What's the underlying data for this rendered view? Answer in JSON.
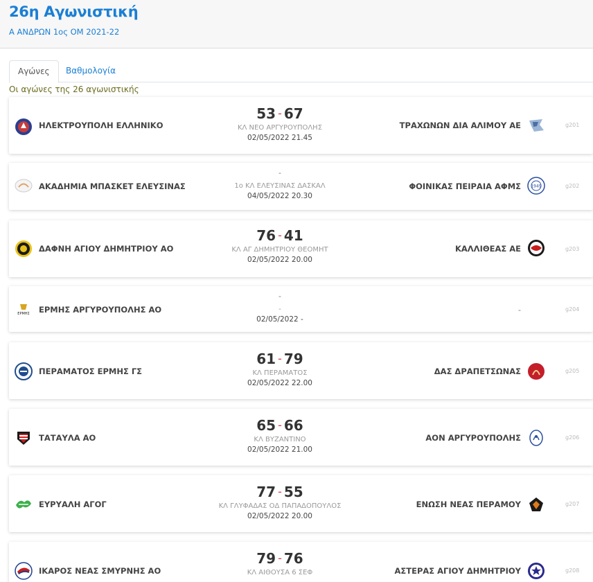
{
  "header": {
    "title": "26η Αγωνιστική",
    "subtitle": "Α ΑΝΔΡΩΝ 1ος ΟΜ 2021-22"
  },
  "tabs": [
    {
      "label": "Αγώνες",
      "active": true
    },
    {
      "label": "Βαθμολογία",
      "active": false
    }
  ],
  "section_caption": "Οι αγώνες της 26 αγωνιστικής",
  "colors": {
    "accent": "#1a7fd4",
    "score_dash": "#cc4444",
    "caption": "#6b6b1e"
  },
  "matches": [
    {
      "home": "ΗΛΕΚΤΡΟΥΠΟΛΗ ΕΛΛΗΝΙΚΟ",
      "away": "ΤΡΑΧΩΝΩΝ ΔΙΑ ΑΛΙΜΟΥ ΑΕ",
      "home_score": "53",
      "away_score": "67",
      "venue": "ΚΛ ΝΕΟ ΑΡΓΥΡΟΥΠΟΛΗΣ",
      "datetime": "02/05/2022 21.45",
      "code": "g201",
      "home_icon": "ilektroupoli-logo-icon",
      "away_icon": "trachonon-logo-icon"
    },
    {
      "home": "ΑΚΑΔΗΜΙΑ ΜΠΑΣΚΕΤ ΕΛΕΥΣΙΝΑΣ",
      "away": "ΦΟΙΝΙΚΑΣ ΠΕΙΡΑΙΑ ΑΦΜΣ",
      "score_text": "-",
      "venue": "1ο ΚΛ ΕΛΕΥΣΙΝΑΣ ΔΑΣΚΑΛ",
      "datetime": "04/05/2022 20.30",
      "code": "g202",
      "home_icon": "akadimia-logo-icon",
      "away_icon": "foinikas-logo-icon",
      "away_logo_text": "1949"
    },
    {
      "home": "ΔΑΦΝΗ ΑΓΙΟΥ ΔΗΜΗΤΡΙΟΥ ΑΟ",
      "away": "ΚΑΛΛΙΘΕΑΣ ΑΕ",
      "home_score": "76",
      "away_score": "41",
      "venue": "ΚΛ ΑΓ ΔΗΜΗΤΡΙΟΥ ΘΕΟΜΗΤ",
      "datetime": "02/05/2022 20.00",
      "code": "g203",
      "home_icon": "dafni-logo-icon",
      "away_icon": "kallithea-logo-icon"
    },
    {
      "home": "ΕΡΜΗΣ ΑΡΓΥΡΟΥΠΟΛΗΣ ΑΟ",
      "away": "-",
      "score_text": "-",
      "venue": "-",
      "datetime": "02/05/2022 -",
      "code": "g204",
      "home_icon": "ermis-logo-icon",
      "home_logo_text": "ΕΡΜΗΣ"
    },
    {
      "home": "ΠΕΡΑΜΑΤΟΣ ΕΡΜΗΣ ΓΣ",
      "away": "ΔΑΣ ΔΡΑΠΕΤΣΩΝΑΣ",
      "home_score": "61",
      "away_score": "79",
      "venue": "ΚΛ ΠΕΡΑΜΑΤΟΣ",
      "datetime": "02/05/2022 22.00",
      "code": "g205",
      "home_icon": "perama-logo-icon",
      "away_icon": "drapetsona-logo-icon"
    },
    {
      "home": "ΤΑΤΑΥΛΑ ΑΟ",
      "away": "ΑΟΝ ΑΡΓΥΡΟΥΠΟΛΗΣ",
      "home_score": "65",
      "away_score": "66",
      "venue": "ΚΛ ΒΥΖΑΝΤΙΝΟ",
      "datetime": "02/05/2022 21.00",
      "code": "g206",
      "home_icon": "tatavla-logo-icon",
      "away_icon": "aon-logo-icon"
    },
    {
      "home": "ΕΥΡΥΑΛΗ ΑΓΟΓ",
      "away": "ΕΝΩΣΗ ΝΕΑΣ ΠΕΡΑΜΟΥ",
      "home_score": "77",
      "away_score": "55",
      "venue": "ΚΛ ΓΛΥΦΑΔΑΣ ΟΔ ΠΑΠΑΔΟΠΟΥΛΟΣ",
      "datetime": "02/05/2022 20.00",
      "code": "g207",
      "home_icon": "euryali-logo-icon",
      "away_icon": "enosi-logo-icon"
    },
    {
      "home": "ΙΚΑΡΟΣ ΝΕΑΣ ΣΜΥΡΝΗΣ ΑΟ",
      "away": "ΑΣΤΕΡΑΣ ΑΓΙΟΥ ΔΗΜΗΤΡΙΟΥ",
      "home_score": "79",
      "away_score": "76",
      "venue": "ΚΛ ΑΙΘΟΥΣΑ 6 ΣΕΦ",
      "datetime": "",
      "code": "g208",
      "home_icon": "ikaros-logo-icon",
      "away_icon": "asteras-logo-icon"
    }
  ]
}
